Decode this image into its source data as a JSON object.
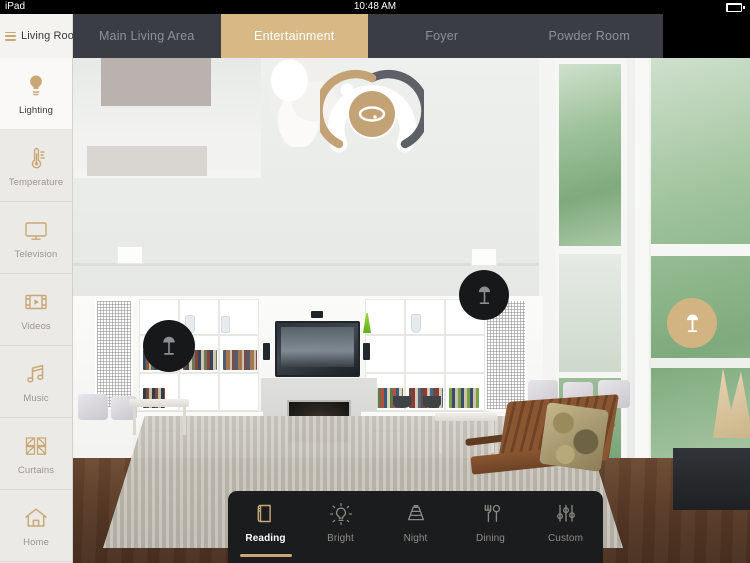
{
  "status_bar": {
    "device": "iPad",
    "time": "10:48 AM",
    "battery_icon": "battery-full-icon"
  },
  "header": {
    "menu_icon": "hamburger-menu-icon",
    "room_label": "Living Room"
  },
  "tabs": [
    {
      "label": "Main Living Area",
      "active": false
    },
    {
      "label": "Entertainment",
      "active": true
    },
    {
      "label": "Foyer",
      "active": false
    },
    {
      "label": "Powder Room",
      "active": false
    }
  ],
  "sidebar": {
    "items": [
      {
        "label": "Lighting",
        "icon": "lightbulb-icon",
        "active": true
      },
      {
        "label": "Temperature",
        "icon": "thermometer-icon",
        "active": false
      },
      {
        "label": "Television",
        "icon": "television-icon",
        "active": false
      },
      {
        "label": "Videos",
        "icon": "video-film-icon",
        "active": false
      },
      {
        "label": "Music",
        "icon": "music-note-icon",
        "active": false
      },
      {
        "label": "Curtains",
        "icon": "curtains-icon",
        "active": false
      },
      {
        "label": "Home",
        "icon": "home-icon",
        "active": false
      }
    ]
  },
  "room_controls": {
    "dimmer": {
      "name": "chandelier-dimmer-dial",
      "icon": "ceiling-light-icon",
      "filled_color": "#c3a375",
      "track_color": "#5d6167",
      "handle_color": "#ffffff"
    },
    "lamp_buttons": [
      {
        "name": "floor-lamp-left-toggle",
        "icon": "table-lamp-icon",
        "state": "off"
      },
      {
        "name": "floor-lamp-right-toggle",
        "icon": "table-lamp-icon",
        "state": "off"
      },
      {
        "name": "accent-lamp-toggle",
        "icon": "table-lamp-icon",
        "state": "on"
      }
    ]
  },
  "scene_bar": {
    "scenes": [
      {
        "label": "Reading",
        "icon": "book-icon",
        "active": true
      },
      {
        "label": "Bright",
        "icon": "sun-bulb-icon",
        "active": false
      },
      {
        "label": "Night",
        "icon": "lampshade-icon",
        "active": false
      },
      {
        "label": "Dining",
        "icon": "cutlery-icon",
        "active": false
      },
      {
        "label": "Custom",
        "icon": "sliders-icon",
        "active": false
      }
    ]
  },
  "colors": {
    "accent_gold": "#d8b885",
    "icon_gold": "#c9a876",
    "tabbar_dark": "#3a3d44",
    "sidebar_bg": "#eceae6",
    "scenebar_bg": "#1b1c1e"
  }
}
